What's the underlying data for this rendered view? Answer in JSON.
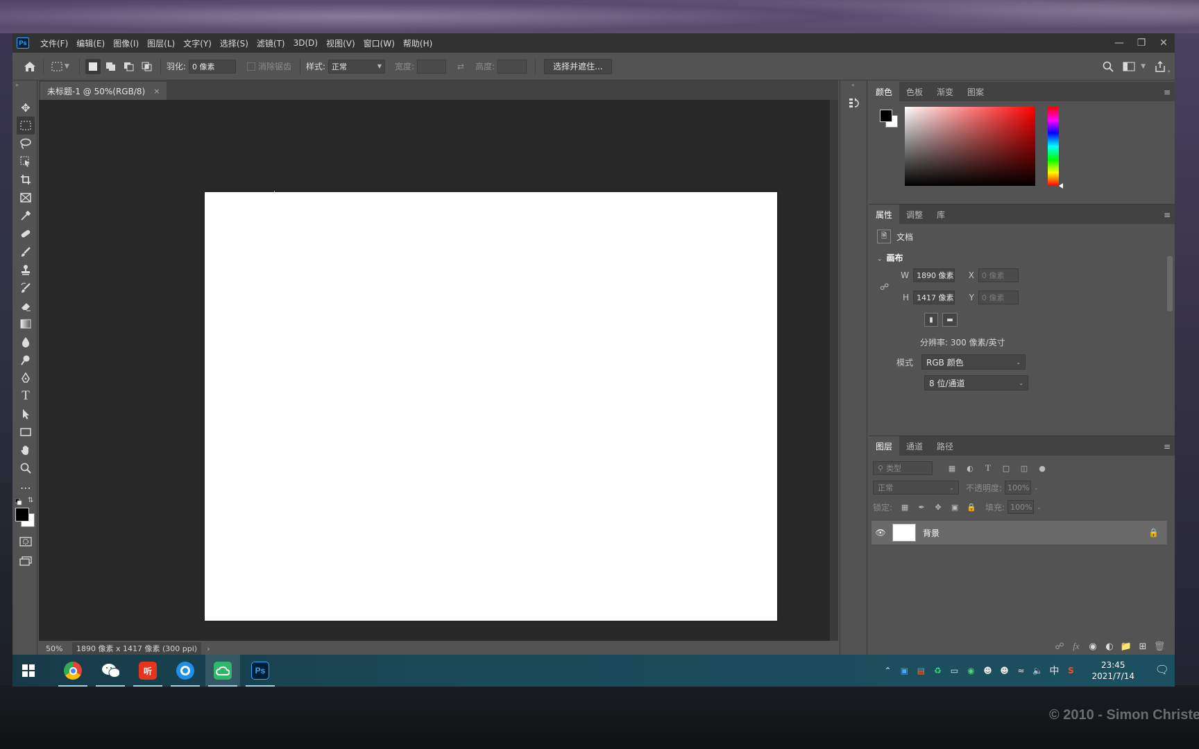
{
  "app": {
    "logo": "Ps"
  },
  "menu": [
    "文件(F)",
    "编辑(E)",
    "图像(I)",
    "图层(L)",
    "文字(Y)",
    "选择(S)",
    "滤镜(T)",
    "3D(D)",
    "视图(V)",
    "窗口(W)",
    "帮助(H)"
  ],
  "options": {
    "feather_label": "羽化:",
    "feather_value": "0 像素",
    "antialias_label": "消除锯齿",
    "style_label": "样式:",
    "style_value": "正常",
    "width_label": "宽度:",
    "height_label": "高度:",
    "select_mask_button": "选择并遮住..."
  },
  "document": {
    "tab_title": "未标题-1 @ 50%(RGB/8)",
    "close": "×"
  },
  "status": {
    "zoom": "50%",
    "info": "1890 像素 x 1417 像素 (300 ppi)",
    "arrow": "›"
  },
  "color_panel": {
    "tabs": [
      "颜色",
      "色板",
      "渐变",
      "图案"
    ],
    "accent": "#ff0000"
  },
  "properties_panel": {
    "tabs": [
      "属性",
      "调整",
      "库"
    ],
    "doc_label": "文档",
    "section": "画布",
    "w_label": "W",
    "w_value": "1890 像素",
    "h_label": "H",
    "h_value": "1417 像素",
    "x_label": "X",
    "x_value": "0 像素",
    "y_label": "Y",
    "y_value": "0 像素",
    "resolution": "分辨率: 300 像素/英寸",
    "mode_label": "模式",
    "mode_value": "RGB 颜色",
    "depth_value": "8 位/通道"
  },
  "layers_panel": {
    "tabs": [
      "图层",
      "通道",
      "路径"
    ],
    "filter_placeholder": "类型",
    "blend_mode": "正常",
    "opacity_label": "不透明度:",
    "opacity_value": "100%",
    "lock_label": "锁定:",
    "fill_label": "填充:",
    "fill_value": "100%",
    "layers": [
      {
        "name": "背景",
        "visible": true,
        "locked": true
      }
    ]
  },
  "taskbar": {
    "apps": [
      {
        "name": "chrome",
        "active": false
      },
      {
        "name": "wechat",
        "active": false
      },
      {
        "name": "listen",
        "label": "听",
        "active": false
      },
      {
        "name": "browser-q",
        "active": false
      },
      {
        "name": "cloud-app",
        "active": true
      },
      {
        "name": "photoshop",
        "label": "Ps",
        "active": false
      }
    ],
    "ime": "中",
    "time": "23:45",
    "date": "2021/7/14"
  },
  "watermark": "© 2010 - Simon Christe"
}
